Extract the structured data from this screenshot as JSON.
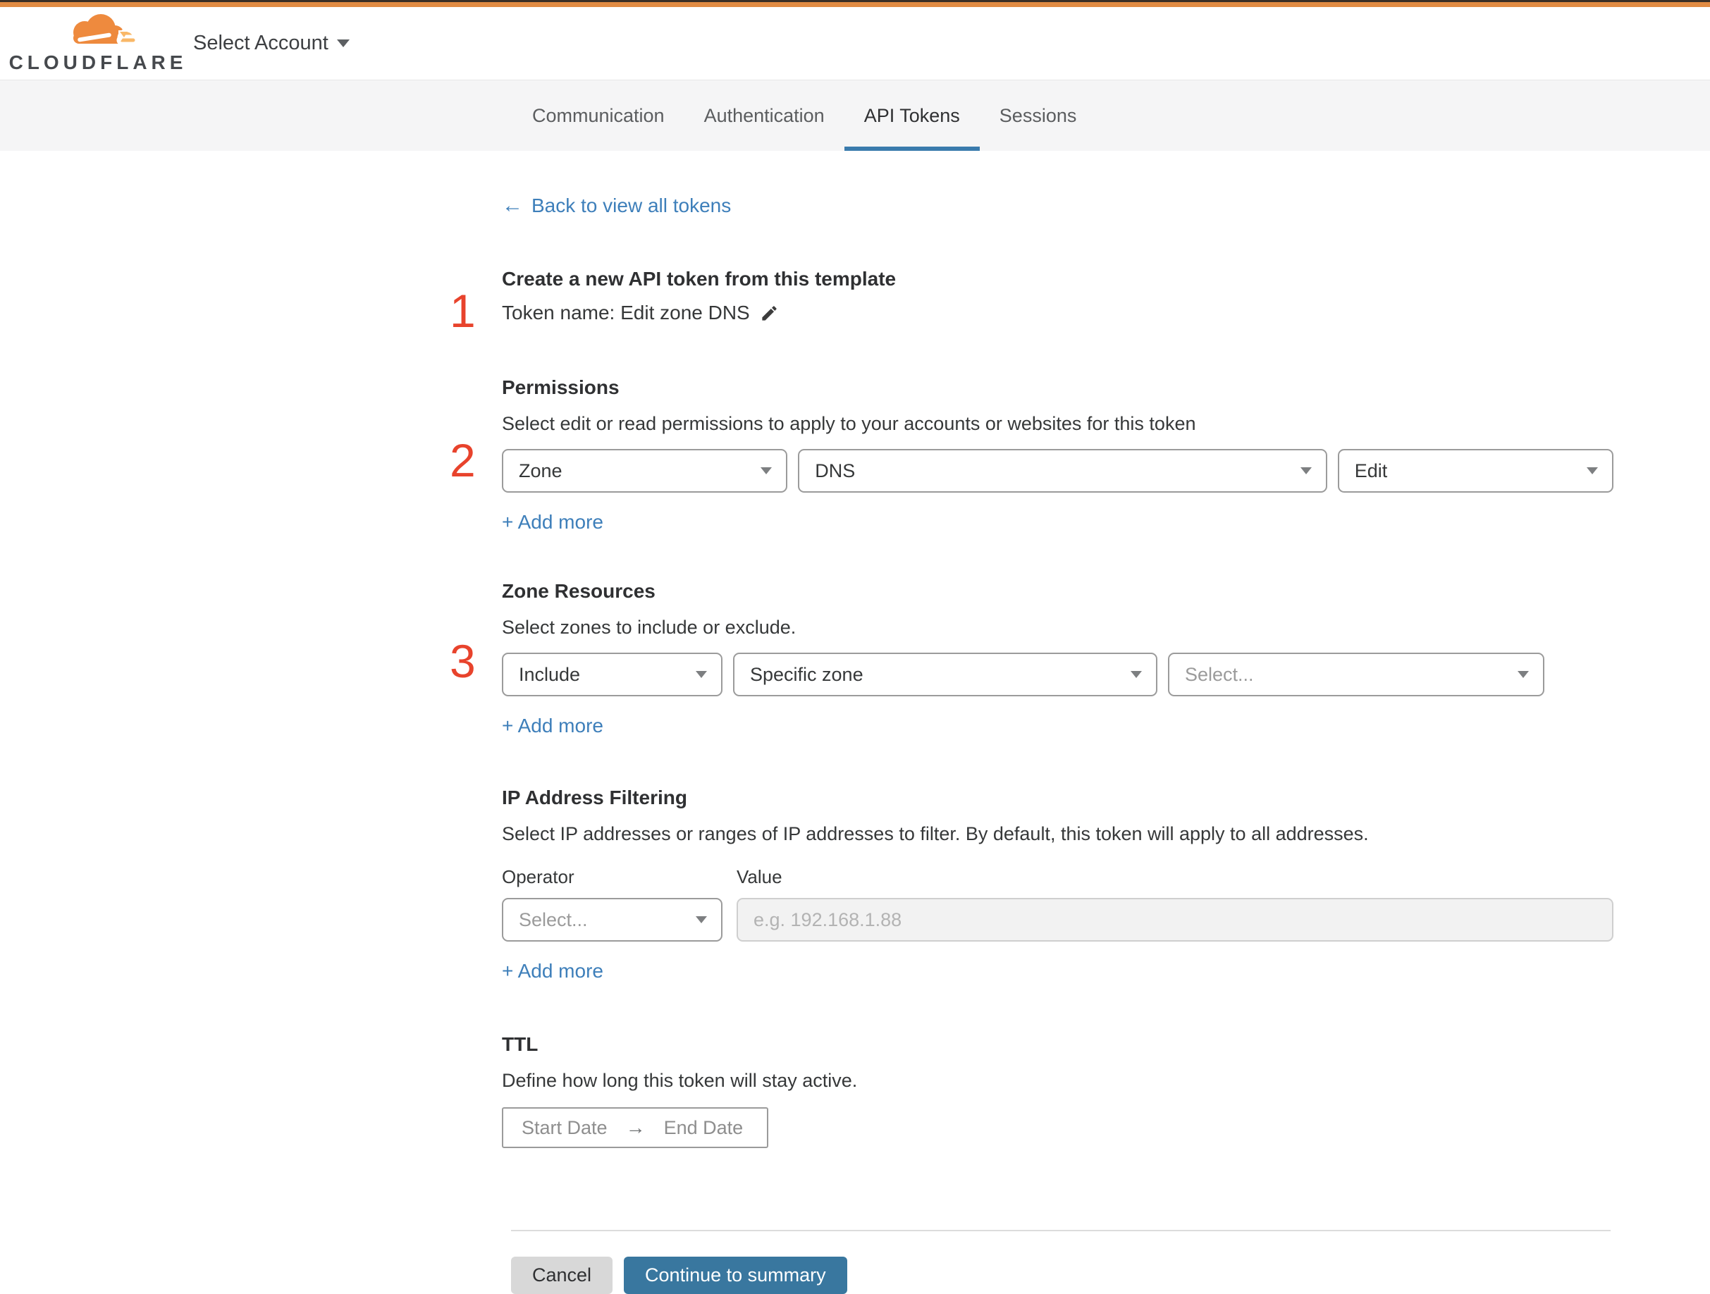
{
  "header": {
    "brand": "CLOUDFLARE",
    "account_selector": "Select Account"
  },
  "tabs": {
    "items": [
      {
        "label": "Communication",
        "active": false
      },
      {
        "label": "Authentication",
        "active": false
      },
      {
        "label": "API Tokens",
        "active": true
      },
      {
        "label": "Sessions",
        "active": false
      }
    ]
  },
  "back": {
    "arrow": "←",
    "label": "Back to view all tokens"
  },
  "sections": {
    "create": {
      "step": "1",
      "title": "Create a new API token from this template",
      "token_name": "Token name: Edit zone DNS"
    },
    "permissions": {
      "step": "2",
      "title": "Permissions",
      "description": "Select edit or read permissions to apply to your accounts or websites for this token",
      "selects": [
        {
          "value": "Zone"
        },
        {
          "value": "DNS"
        },
        {
          "value": "Edit"
        }
      ],
      "add_more": "+ Add more"
    },
    "zone_resources": {
      "step": "3",
      "title": "Zone Resources",
      "description": "Select zones to include or exclude.",
      "selects": [
        {
          "value": "Include"
        },
        {
          "value": "Specific zone"
        },
        {
          "value": "Select..."
        }
      ],
      "add_more": "+ Add more"
    },
    "ip_filtering": {
      "title": "IP Address Filtering",
      "description": "Select IP addresses or ranges of IP addresses to filter. By default, this token will apply to all addresses.",
      "operator_label": "Operator",
      "value_label": "Value",
      "operator_select": "Select...",
      "value_placeholder": "e.g. 192.168.1.88",
      "add_more": "+ Add more"
    },
    "ttl": {
      "title": "TTL",
      "description": "Define how long this token will stay active.",
      "start_placeholder": "Start Date",
      "range_arrow": "→",
      "end_placeholder": "End Date"
    }
  },
  "footer": {
    "cancel": "Cancel",
    "continue": "Continue to summary"
  },
  "colors": {
    "top_bar_orange": "#e18b43",
    "link_blue": "#3e7fba",
    "button_blue": "#39779f",
    "tab_underline_blue": "#3a7bad",
    "step_number_red": "#e8432c",
    "logo_cloud_orange": "#ee8a3e",
    "logo_cloud_yellow": "#f9b868"
  }
}
